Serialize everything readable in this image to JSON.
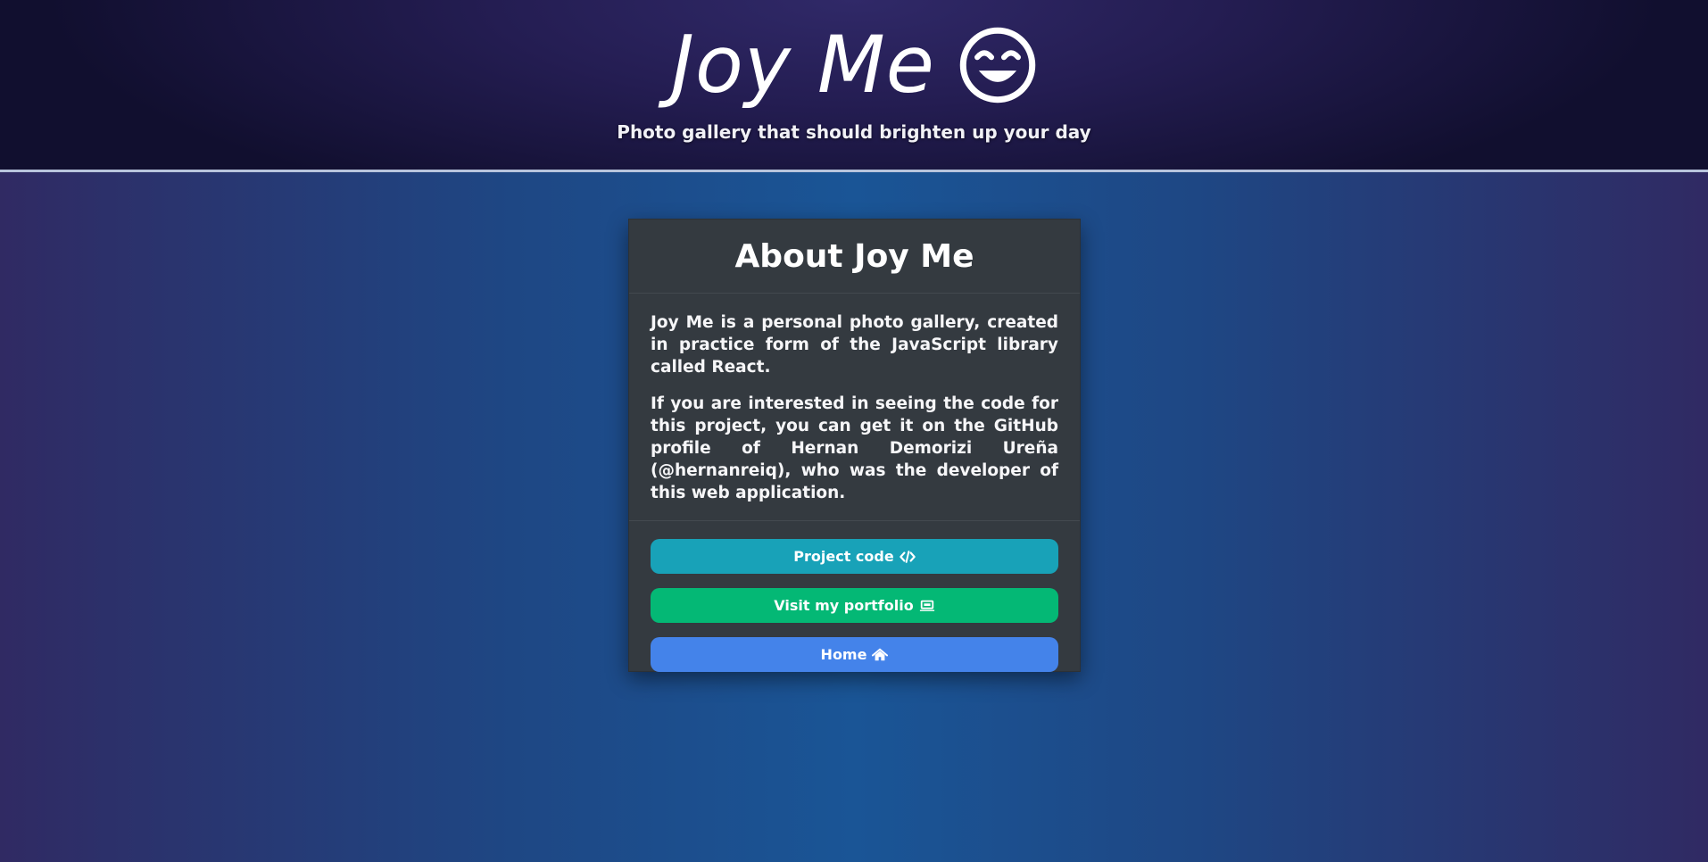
{
  "header": {
    "title": "Joy Me",
    "tagline": "Photo gallery that should brighten up your day",
    "logo_icon": "smiley-face-icon"
  },
  "card": {
    "title": "About Joy Me",
    "paragraphs": [
      "Joy Me is a personal photo gallery, created in practice form of the JavaScript library called React.",
      "If you are interested in seeing the code for this project, you can get it on the GitHub profile of Hernan Demorizi Ureña (@hernanreiq), who was the developer of this web application."
    ],
    "buttons": [
      {
        "label": "Project code",
        "icon": "code-icon",
        "color": "#18a2b8"
      },
      {
        "label": "Visit my portfolio",
        "icon": "laptop-icon",
        "color": "#04b875"
      },
      {
        "label": "Home",
        "icon": "home-icon",
        "color": "#4483ea"
      }
    ]
  },
  "colors": {
    "card_background": "#343a40",
    "header_background": "#241d52",
    "page_background": "#1e4784"
  }
}
